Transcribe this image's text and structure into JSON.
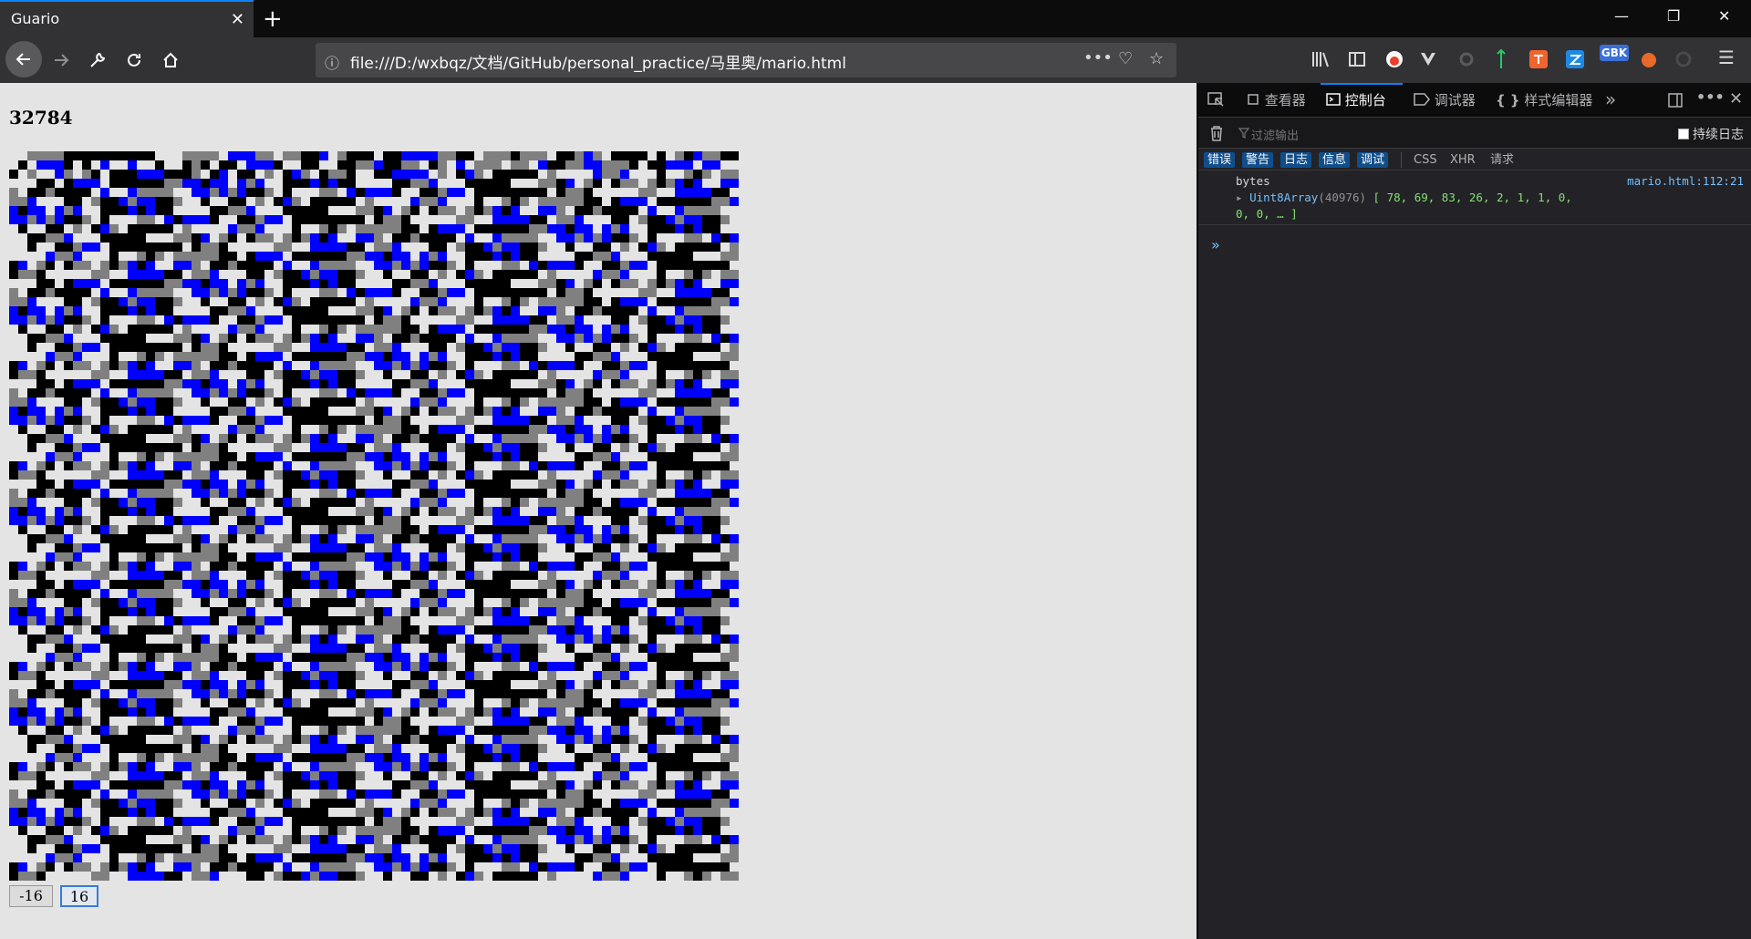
{
  "tab": {
    "title": "Guario",
    "close": "✕",
    "new_tab": "+"
  },
  "window": {
    "minimize": "—",
    "restore": "❐",
    "close": "✕"
  },
  "nav": {
    "url": "file:///D:/wxbqz/文档/GitHub/personal_practice/马里奥/mario.html",
    "info_icon": "ⓘ",
    "page_actions": "•••",
    "pocket_icon": "♡",
    "bookmark_icon": "☆"
  },
  "toolbar": {
    "gbk_badge": "GBK",
    "menu_icon": "☰"
  },
  "page": {
    "score": "32784",
    "btn_minus": "-16",
    "btn_plus": "16"
  },
  "colors": {
    "sprite_black": "#000000",
    "sprite_gray": "#808080",
    "sprite_blue": "#0000ff",
    "page_bg": "#e4e4e4",
    "accent": "#0a84ff"
  },
  "devtools": {
    "tabs": {
      "inspector": "查看器",
      "console": "控制台",
      "debugger": "调试器",
      "style_editor": "样式编辑器"
    },
    "filter_placeholder": "过滤输出",
    "persist_logs": "持续日志",
    "levels": {
      "errors": "错误",
      "warnings": "警告",
      "logs": "日志",
      "info": "信息",
      "debug": "调试"
    },
    "net_filters": {
      "css": "CSS",
      "xhr": "XHR",
      "requests": "请求"
    },
    "log": {
      "label": "bytes",
      "source": "mario.html:112:21",
      "type": "Uint8Array",
      "length": "(40976)",
      "values_line1": "[ 78, 69, 83, 26, 2, 1, 1, 0,",
      "values_line2": "0, 0, … ]"
    },
    "prompt": "»"
  }
}
